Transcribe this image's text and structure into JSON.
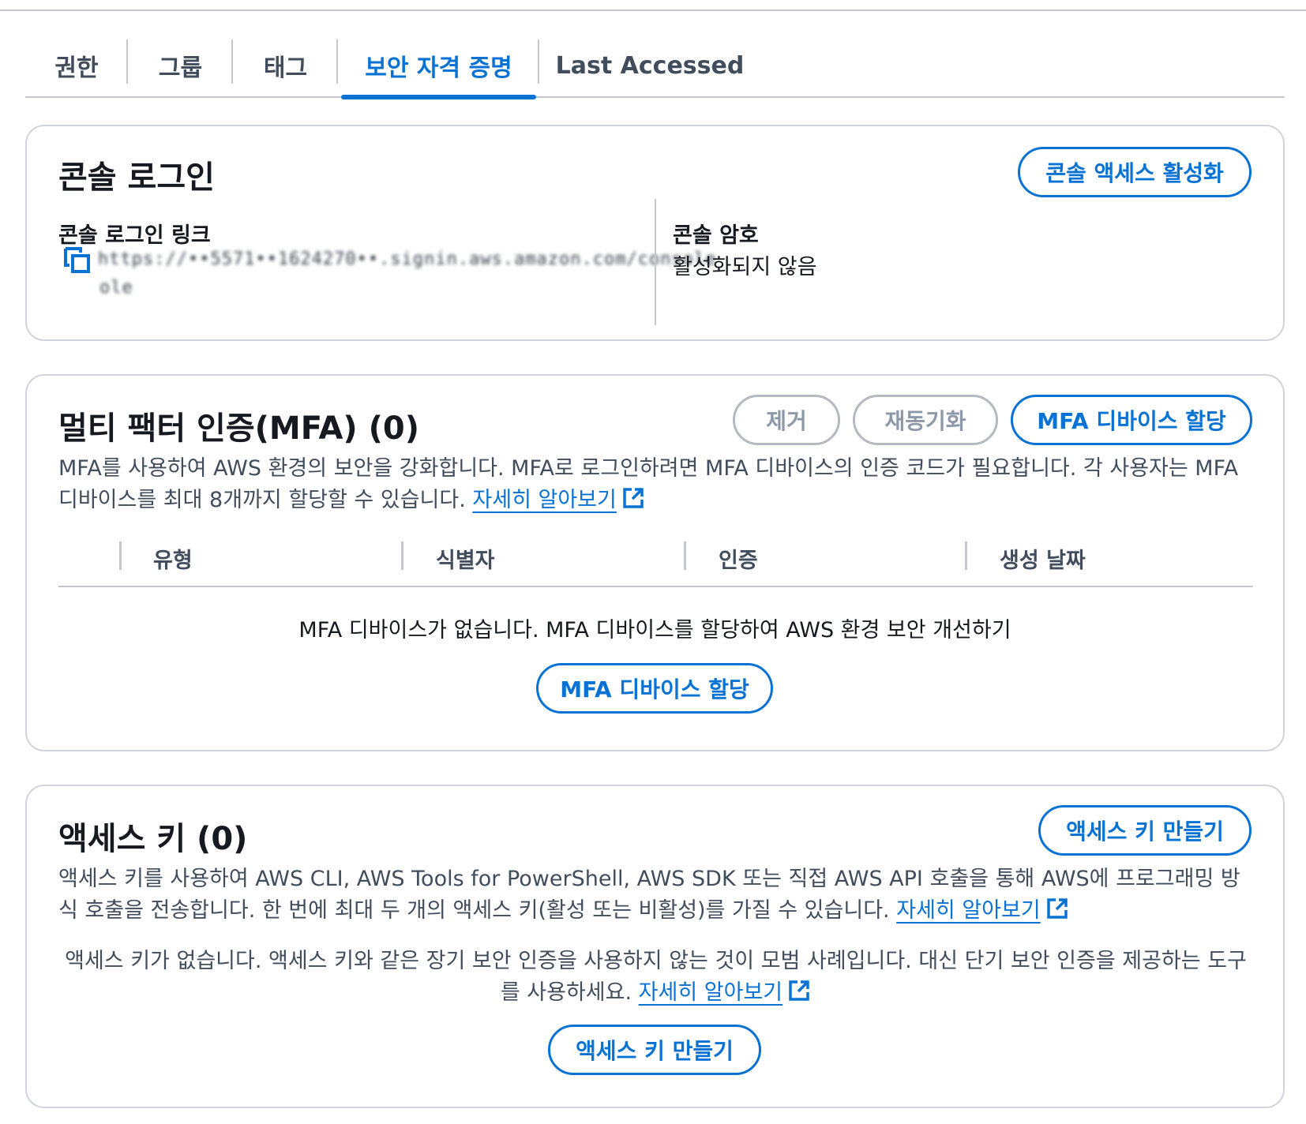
{
  "tabs": [
    {
      "label": "권한"
    },
    {
      "label": "그룹"
    },
    {
      "label": "태그"
    },
    {
      "label": "보안 자격 증명",
      "active": true
    },
    {
      "label": "Last Accessed"
    }
  ],
  "console_signin": {
    "title": "콘솔 로그인",
    "enable_button": "콘솔 액세스 활성화",
    "link_label": "콘솔 로그인 링크",
    "link_value_line1": "https://••5571••1624270••.signin.aws.amazon.com/console",
    "link_value_line2": "ole",
    "password_label": "콘솔 암호",
    "password_value": "활성화되지 않음"
  },
  "mfa": {
    "title": "멀티 팩터 인증(MFA) (0)",
    "remove_button": "제거",
    "resync_button": "재동기화",
    "assign_button": "MFA 디바이스 할당",
    "description": "MFA를 사용하여 AWS 환경의 보안을 강화합니다. MFA로 로그인하려면 MFA 디바이스의 인증 코드가 필요합니다. 각 사용자는 MFA 디바이스를 최대 8개까지 할당할 수 있습니다.",
    "learn_more": "자세히 알아보기",
    "columns": [
      "유형",
      "식별자",
      "인증",
      "생성 날짜"
    ],
    "empty_text": "MFA 디바이스가 없습니다. MFA 디바이스를 할당하여 AWS 환경 보안 개선하기",
    "empty_button": "MFA 디바이스 할당"
  },
  "access_keys": {
    "title": "액세스 키 (0)",
    "create_button": "액세스 키 만들기",
    "description": "액세스 키를 사용하여 AWS CLI, AWS Tools for PowerShell, AWS SDK 또는 직접 AWS API 호출을 통해 AWS에 프로그래밍 방식 호출을 전송합니다. 한 번에 최대 두 개의 액세스 키(활성 또는 비활성)를 가질 수 있습니다.",
    "learn_more": "자세히 알아보기",
    "empty_text": "액세스 키가 없습니다. 액세스 키와 같은 장기 보안 인증을 사용하지 않는 것이 모범 사례입니다. 대신 단기 보안 인증을 제공하는 도구를 사용하세요.",
    "empty_learn_more": "자세히 알아보기",
    "empty_button": "액세스 키 만들기"
  },
  "colors": {
    "accent": "#0972d3",
    "border": "#d1d5db",
    "text": "#16191f",
    "secondary_text": "#414d5c",
    "disabled": "#8d99a8"
  }
}
